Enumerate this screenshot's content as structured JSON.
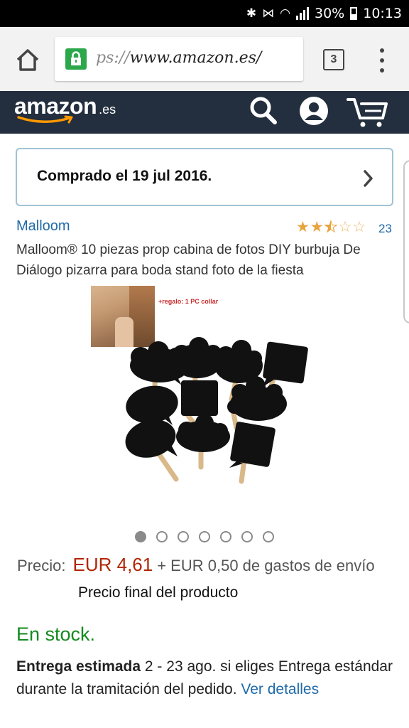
{
  "status_bar": {
    "battery": "30%",
    "time": "10:13"
  },
  "browser": {
    "url_prefix": "ps://",
    "url_domain": "www.amazon.es/",
    "url_suffix": "",
    "tab_count": "3"
  },
  "header": {
    "logo_word": "amazon",
    "logo_tld": ".es",
    "brand_color": "#232f3e",
    "accent_color": "#ff9900"
  },
  "purchased": {
    "text": "Comprado el 19 jul 2016."
  },
  "product": {
    "brand": "Malloom",
    "rating_out_of_5": 2.5,
    "review_count": "23",
    "title": "Malloom® 10 piezas prop cabina de fotos DIY burbuja De Diálogo pizarra para boda stand foto de la fiesta",
    "image_gift_note": "+regalo: 1 PC collar"
  },
  "carousel": {
    "total": 7,
    "active_index": 0
  },
  "pricing": {
    "label": "Precio:",
    "price": "EUR 4,61",
    "shipping": "+ EUR 0,50 de gastos de envío",
    "final_note": "Precio final del producto"
  },
  "availability": {
    "stock": "En stock."
  },
  "delivery": {
    "label": "Entrega estimada",
    "text": "2 - 23 ago. si eliges Entrega estándar durante la tramitación del pedido.",
    "link": "Ver detalles"
  },
  "icons": {
    "home": "home-icon",
    "lock": "lock-icon",
    "tabs": "tabs-icon",
    "menu": "more-vert-icon",
    "search": "search-icon",
    "account": "account-icon",
    "cart": "cart-icon",
    "chevron": "chevron-right-icon"
  }
}
